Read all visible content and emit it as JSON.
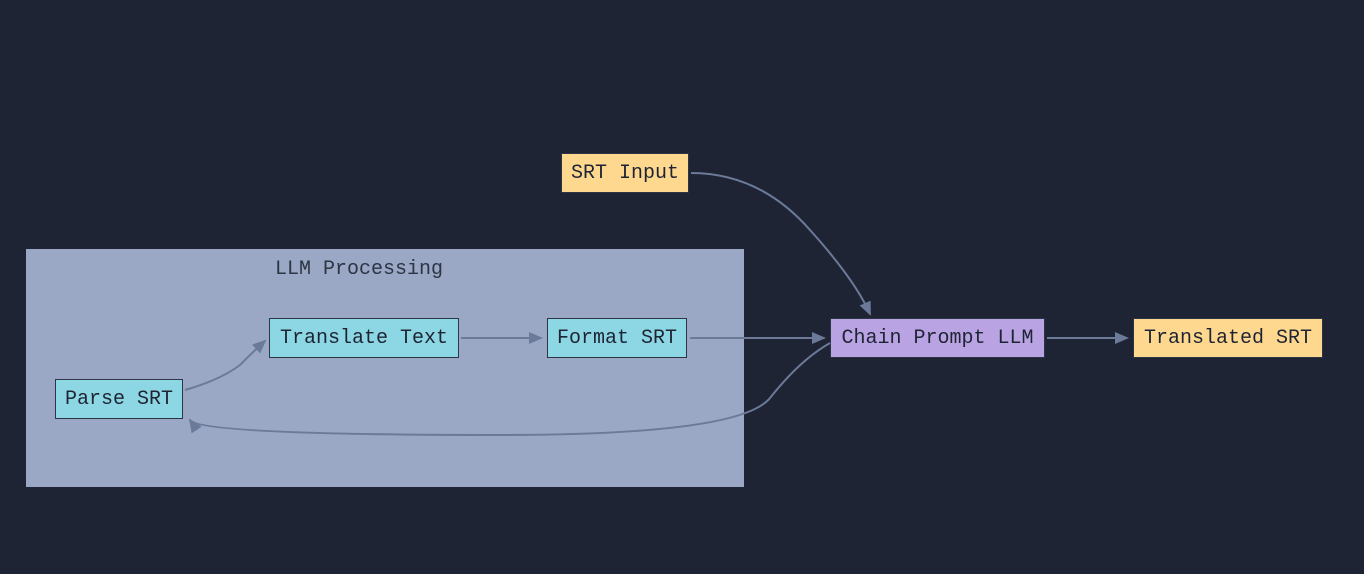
{
  "container": {
    "title": "LLM Processing"
  },
  "nodes": {
    "srt_input": "SRT Input",
    "parse_srt": "Parse SRT",
    "translate_text": "Translate Text",
    "format_srt": "Format SRT",
    "chain_prompt": "Chain Prompt LLM",
    "translated_srt": "Translated SRT"
  }
}
